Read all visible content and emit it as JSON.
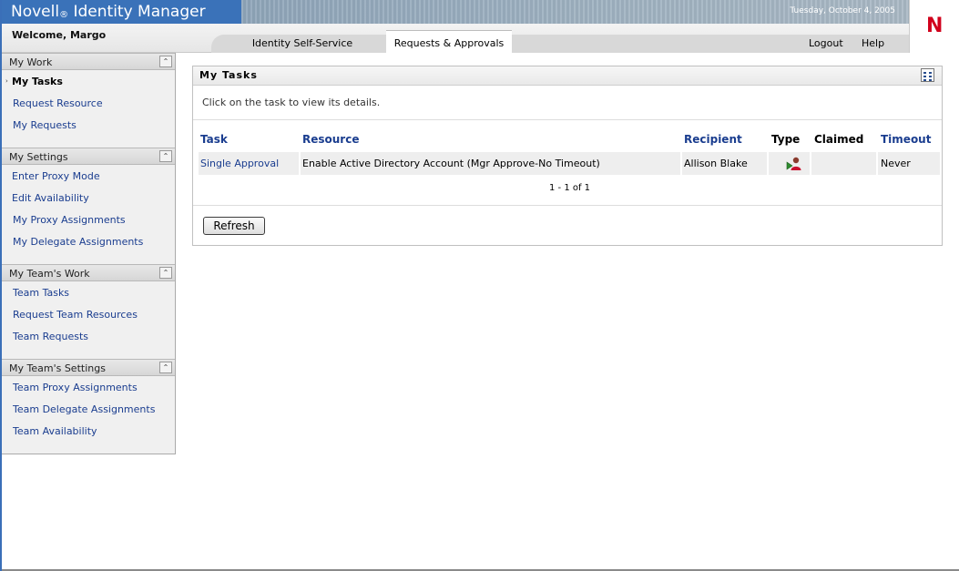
{
  "app": {
    "brand_prefix": "Novell",
    "brand_reg": "®",
    "brand_suffix": " Identity Manager",
    "date": "Tuesday, October 4, 2005",
    "logo_letter": "N",
    "welcome": "Welcome, Margo"
  },
  "tabs": [
    {
      "label": "Identity Self-Service",
      "active": false
    },
    {
      "label": "Requests & Approvals",
      "active": true
    }
  ],
  "header_links": {
    "logout": "Logout",
    "help": "Help"
  },
  "sidebar": {
    "sections": [
      {
        "title": "My Work",
        "items": [
          "My Tasks",
          "Request Resource",
          "My Requests"
        ]
      },
      {
        "title": "My Settings",
        "items": [
          "Enter Proxy Mode",
          "Edit Availability",
          "My Proxy Assignments",
          "My Delegate Assignments"
        ]
      },
      {
        "title": "My Team's Work",
        "items": [
          "Team Tasks",
          "Request Team Resources",
          "Team Requests"
        ]
      },
      {
        "title": "My Team's Settings",
        "items": [
          "Team Proxy Assignments",
          "Team Delegate Assignments",
          "Team Availability"
        ]
      }
    ],
    "current_item": "My Tasks",
    "current_marker": "›",
    "collapse_glyph": "⌃"
  },
  "main": {
    "title": "My Tasks",
    "instructions": "Click on the task to view its details.",
    "columns": [
      "Task",
      "Resource",
      "Recipient",
      "Type",
      "Claimed",
      "Timeout"
    ],
    "rows": [
      {
        "task": "Single Approval",
        "resource": "Enable Active Directory Account (Mgr Approve-No Timeout)",
        "recipient": "Allison Blake",
        "type_icon": "approval-task-icon",
        "claimed": "",
        "timeout": "Never"
      }
    ],
    "pagination": "1 - 1 of 1",
    "refresh_label": "Refresh"
  },
  "colors": {
    "brand_blue": "#3a72b9",
    "link_blue": "#1a3d8f",
    "logo_red": "#d1001c"
  }
}
